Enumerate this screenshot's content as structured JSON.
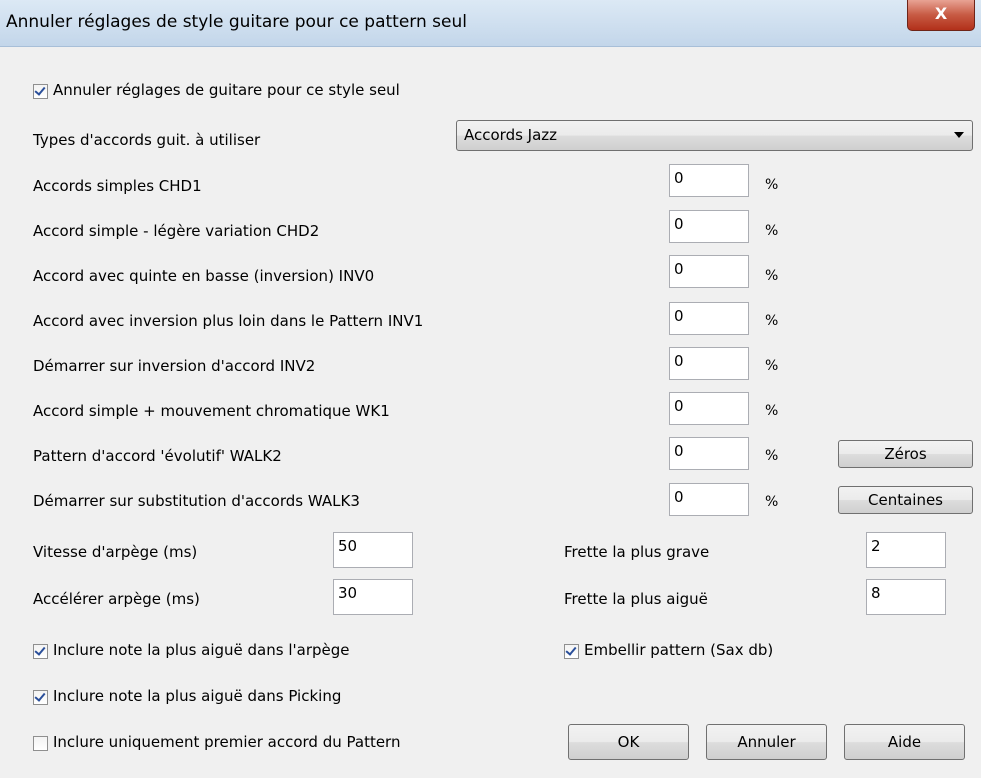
{
  "window": {
    "title": "Annuler réglages de style guitare pour ce pattern seul",
    "close_label": "X"
  },
  "override": {
    "label": "Annuler réglages de guitare pour ce style seul",
    "checked": true
  },
  "chord_types": {
    "label": "Types d'accords guit. à utiliser",
    "value": "Accords Jazz"
  },
  "percent_rows": [
    {
      "label": "Accords simples  CHD1",
      "value": "0",
      "unit": "%"
    },
    {
      "label": "Accord simple - légère variation   CHD2",
      "value": "0",
      "unit": "%"
    },
    {
      "label": "Accord avec quinte en basse (inversion)  INV0",
      "value": "0",
      "unit": "%"
    },
    {
      "label": "Accord avec inversion plus loin dans le Pattern  INV1",
      "value": "0",
      "unit": "%"
    },
    {
      "label": "Démarrer sur inversion d'accord  INV2",
      "value": "0",
      "unit": "%"
    },
    {
      "label": "Accord simple + mouvement chromatique  WK1",
      "value": "0",
      "unit": "%"
    },
    {
      "label": "Pattern d'accord 'évolutif'  WALK2",
      "value": "0",
      "unit": "%"
    },
    {
      "label": "Démarrer sur substitution d'accords  WALK3",
      "value": "0",
      "unit": "%"
    }
  ],
  "buttons": {
    "zeros": "Zéros",
    "hundreds": "Centaines",
    "ok": "OK",
    "cancel": "Annuler",
    "help": "Aide"
  },
  "arpeggio_speed": {
    "label": "Vitesse d'arpège (ms)",
    "value": "50"
  },
  "arpeggio_accel": {
    "label": "Accélérer arpège (ms)",
    "value": "30"
  },
  "lowest_fret": {
    "label": "Frette la plus grave",
    "value": "2"
  },
  "highest_fret": {
    "label": "Frette la plus aiguë",
    "value": "8"
  },
  "checkboxes": {
    "include_top_arpeggio": {
      "label": "Inclure note la plus aiguë dans l'arpège",
      "checked": true
    },
    "embellish": {
      "label": "Embellir pattern (Sax db)",
      "checked": true
    },
    "include_top_picking": {
      "label": "Inclure note la plus aiguë dans Picking",
      "checked": true
    },
    "first_chord_only": {
      "label": "Inclure uniquement premier accord du Pattern",
      "checked": false
    }
  },
  "colors": {
    "titlebar": "#c3d6ea",
    "dialog_bg": "#f0f0f0",
    "close_button": "#c75a43"
  }
}
